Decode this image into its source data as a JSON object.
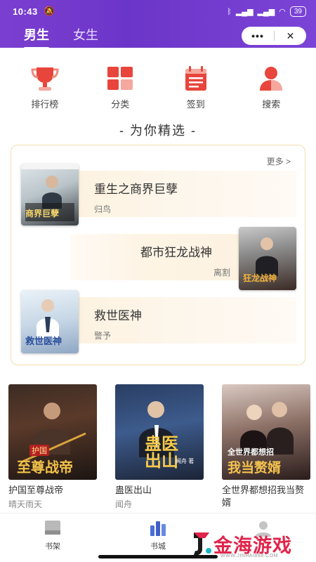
{
  "status_bar": {
    "time": "10:43",
    "battery": "39"
  },
  "header": {
    "tabs": [
      {
        "label": "男生",
        "active": true
      },
      {
        "label": "女生",
        "active": false
      }
    ],
    "capsule_more": "•••",
    "capsule_close": "✕",
    "accent_color": "#7038cc"
  },
  "quick_nav": [
    {
      "label": "排行榜",
      "icon": "trophy-icon"
    },
    {
      "label": "分类",
      "icon": "category-grid-icon"
    },
    {
      "label": "签到",
      "icon": "calendar-checkin-icon"
    },
    {
      "label": "搜索",
      "icon": "user-search-icon"
    }
  ],
  "section_title": "- 为你精选 -",
  "featured": {
    "more_label": "更多 >",
    "books": [
      {
        "title": "重生之商界巨孽",
        "author": "归鸟",
        "cover_text": "商界巨孽"
      },
      {
        "title": "都市狂龙战神",
        "author": "离割",
        "cover_text": "狂龙战神"
      },
      {
        "title": "救世医神",
        "author": "警予",
        "cover_text": "救世医神"
      }
    ]
  },
  "grid_books": [
    {
      "title": "护国至尊战帝",
      "author": "晴天雨天",
      "cover_text": "至尊战帝",
      "cover_sub": "护国"
    },
    {
      "title": "蛊医出山",
      "author": "闻舟",
      "cover_text": "蛊医出山",
      "cover_sub": "闻舟 著"
    },
    {
      "title": "全世界都想招我当赘婿",
      "author": "",
      "cover_text": "我当赘婿",
      "cover_sub": "全世界都想招"
    }
  ],
  "bottom_nav": [
    {
      "label": "书架",
      "icon": "bookshelf-icon"
    },
    {
      "label": "书城",
      "icon": "bookstore-icon"
    },
    {
      "label": "",
      "icon": "profile-icon"
    }
  ],
  "watermark": {
    "text": "金海游戏",
    "url": "WWW.JINHAI888.COM"
  }
}
